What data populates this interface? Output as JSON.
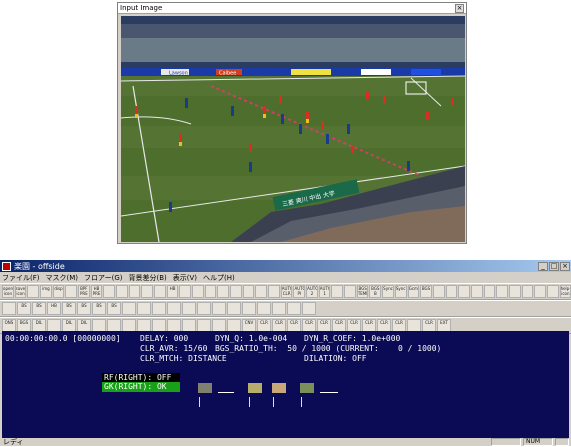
{
  "image_window": {
    "title": "Input Image",
    "close_glyph": "×"
  },
  "field_texts": {
    "banner_left": "Lawson",
    "banner_mid": "Calbee",
    "center_banner": "三菱 爽川 中出 大学"
  },
  "app": {
    "title": "楽園 - offside",
    "menu": [
      "ファイル(F)",
      "マスク(M)",
      "フロアー(G)",
      "背景差分(B)",
      "表示(V)",
      "ヘルプ(H)"
    ],
    "toolbar_rows": [
      [
        "open-icon",
        "save-icon",
        "",
        "img",
        "disp",
        "",
        "BPF\nPRE",
        "HB\nPRE",
        "",
        "",
        "",
        "",
        "",
        "HB",
        "",
        "",
        "",
        "",
        "",
        "",
        "",
        "",
        "AUTO\nCLR",
        "AUTO\nPI",
        "AUTO\n2",
        "AUTO\n1",
        "",
        "",
        "BGS\nTEMP",
        "BGS\nB",
        "Sync",
        "Sync",
        "Gcm",
        "BGS",
        "",
        "",
        "",
        "",
        "",
        "",
        "",
        "",
        "",
        "",
        "help-icon"
      ],
      [
        "",
        "BS",
        "BS",
        "HB",
        "BS",
        "BS",
        "BS",
        "BS",
        "",
        "",
        "",
        "",
        "",
        "",
        "",
        "",
        "",
        "",
        "",
        "",
        ""
      ],
      [
        "ONS",
        "BGS",
        "DIL",
        "",
        "DIL",
        "DIL",
        "",
        "",
        "",
        "",
        "",
        "",
        "",
        "",
        "",
        "",
        "CNV",
        "CLR",
        "CLR",
        "CLR",
        "CLR",
        "CLR",
        "CLR",
        "CLR",
        "CLR",
        "CLR",
        "CLR",
        "",
        "CLR",
        "EXT"
      ]
    ],
    "monitor": {
      "timecode": "00:00:00:00.0 [00000000]",
      "delay": "DELAY: 000",
      "dyn_q": "DYN_Q: 1.0e-004",
      "dyn_r": "DYN_R_COEF: 1.0e+000",
      "clr_avr": "CLR_AVR: 15/60",
      "bgs_ratio": "BGS_RATIO_TH:  50 / 1000 (CURRENT:    0 / 1000)",
      "clr_mtch": "CLR_MTCH: DISTANCE",
      "dilation": "DILATION: OFF",
      "rf": "RF(RIGHT): OFF",
      "gk": "GK(RIGHT): OK"
    },
    "status": {
      "left": "レディ",
      "num": "NUM"
    }
  },
  "colors": {
    "monitor_bg": "#0a0a55",
    "gk_box": "#18a018",
    "swatch1": "#808070",
    "swatch2": "#b8ac6c",
    "swatch3": "#c8a878",
    "swatch4": "#7a9058"
  }
}
